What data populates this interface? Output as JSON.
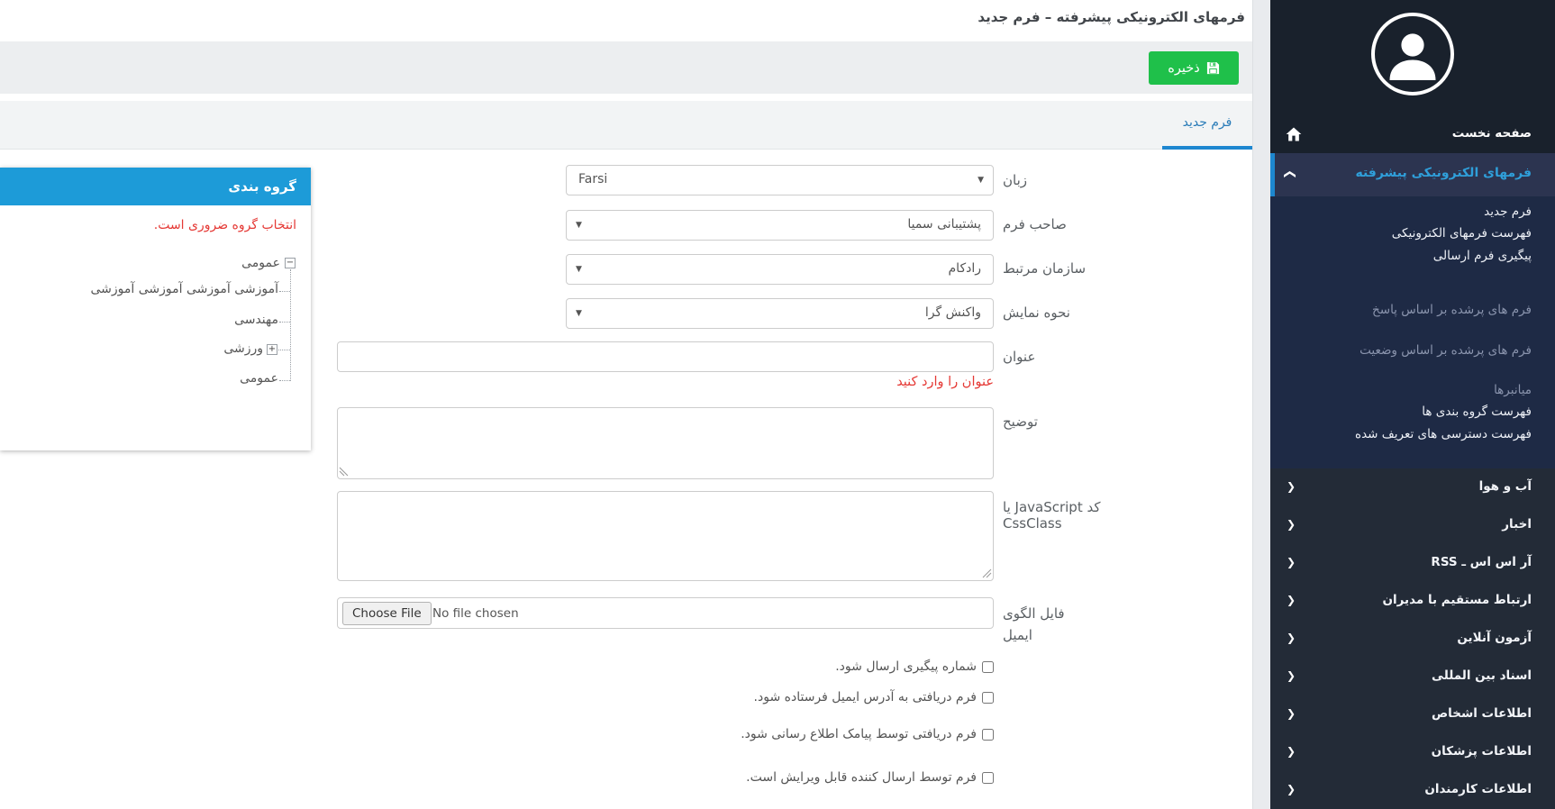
{
  "title_bar": {
    "title": "فرمهای الکترونیکی پیشرفته – فرم جدید"
  },
  "toolbar": {
    "save_label": "ذخیره"
  },
  "tabs": {
    "active_label": "فرم جدید"
  },
  "grouping_panel": {
    "header": "گروه بندی",
    "error": "انتخاب گروه ضروری است.",
    "tree": {
      "root": {
        "label": "عمومی",
        "expander": "minus",
        "expander_glyph": "−"
      },
      "plus_glyph": "+",
      "children": [
        {
          "label": "آموزشی آموزشی آموزشی آموزشی"
        },
        {
          "label": "مهندسی"
        },
        {
          "label": "ورزشی",
          "expander": "plus"
        },
        {
          "label": "عمومی"
        }
      ]
    }
  },
  "form": {
    "language": {
      "label": "زبان",
      "value": "Farsi"
    },
    "owner": {
      "label": "صاحب فرم",
      "value": "پشتیبانی سمیا"
    },
    "organization": {
      "label": "سازمان مرتبط",
      "value": "رادکام"
    },
    "display_mode": {
      "label": "نحوه نمایش",
      "value": "واکنش گرا"
    },
    "title_field": {
      "label": "عنوان",
      "value": "",
      "error": "عنوان را وارد کنید"
    },
    "description": {
      "label": "توضیح",
      "value": ""
    },
    "code": {
      "label": "کد JavaScript یا CssClass",
      "value": ""
    },
    "email_template": {
      "label_line1": "فایل الگوی",
      "label_line2": "ایمیل",
      "button_label": "Choose File",
      "status": "No file chosen"
    },
    "checkboxes": [
      {
        "label": "شماره پیگیری ارسال شود.",
        "checked": false
      },
      {
        "label": "فرم دریافتی به آدرس ایمیل فرستاده شود.",
        "checked": false
      },
      {
        "label": "فرم دریافتی توسط پیامک اطلاع رسانی شود.",
        "checked": false
      },
      {
        "label": "فرم توسط ارسال کننده قابل ویرایش است.",
        "checked": false
      }
    ]
  },
  "sidebar": {
    "home": {
      "label": "صفحه نخست"
    },
    "active_item": {
      "label": "فرمهای الکترونیکی پیشرفته"
    },
    "submenu": [
      {
        "label": "فرم جدید"
      },
      {
        "label": "فهرست فرمهای الکترونیکی"
      },
      {
        "label": "پیگیری فرم ارسالی"
      },
      {
        "label": "فرم های پرشده بر اساس پاسخ"
      },
      {
        "label": "فرم های پرشده بر اساس وضعیت"
      },
      {
        "label": "میانبرها"
      },
      {
        "label": "فهرست گروه بندی ها"
      },
      {
        "label": "فهرست دسترسی های تعریف شده"
      }
    ],
    "sections": [
      {
        "label": "آب و هوا"
      },
      {
        "label": "اخبار"
      },
      {
        "label": "آر اس اس ـ RSS"
      },
      {
        "label": "ارتباط مستقیم با مدیران"
      },
      {
        "label": "آزمون آنلاین"
      },
      {
        "label": "اسناد بین المللی"
      },
      {
        "label": "اطلاعات اشخاص"
      },
      {
        "label": "اطلاعات پزشکان"
      },
      {
        "label": "اطلاعات کارمندان"
      }
    ],
    "chevron_glyph": "❮"
  },
  "colors": {
    "save_green": "#1fc04a",
    "accent_blue": "#1e87d0",
    "tab_blue": "#2a7cb8",
    "error_red": "#e53935",
    "panel_header_blue": "#1d9bd8",
    "sidebar_dark": "#19212c",
    "sidebar_navy": "#1e2a45",
    "sidebar_active": "#2c3450",
    "sidebar_section": "#232b37",
    "active_link_blue": "#2f9fda"
  }
}
